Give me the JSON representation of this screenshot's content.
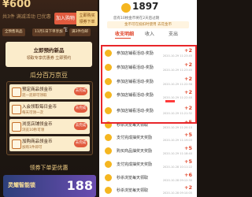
{
  "left": {
    "price": "¥600",
    "sub": "共3件 满减活动 已优惠",
    "cart_label": "加入购物车",
    "buy_label": "立即购买",
    "buy_sub": "领券下单",
    "tags": [
      "全预售商品",
      "11月1日下单享加",
      "满3件包邮"
    ],
    "coupon_title": "立即预约新品",
    "coupon_sub": "领取专享优惠券 立即预约",
    "section_title": "瓜分百万京豆",
    "tasks": [
      {
        "title": "预定商品领金币",
        "sub": "逛一逛即可领取",
        "go": "去完成"
      },
      {
        "title": "入会领取每日金币",
        "sub": "每天可领一次",
        "go": "去完成"
      },
      {
        "title": "浏览店铺领金币",
        "sub": "浏览10秒可领",
        "go": "去完成"
      },
      {
        "title": "加购商品领金币",
        "sub": "加购1件即可",
        "go": "去完成"
      }
    ],
    "order_title": "领券下单更优惠",
    "promo_title": "灵耀智能锁",
    "promo_num": "188"
  },
  "right": {
    "coin_count": "1897",
    "sub": "您有10枚金币将在2天后过期",
    "tip": "金币可在抵扣时使用 去花金币",
    "tabs": [
      "收支明细",
      "收入",
      "支出"
    ],
    "rows": [
      {
        "label": "参加店铺看活动-奖励",
        "value": "+2",
        "time": "2020-10-29 11:23:45"
      },
      {
        "label": "参加店铺看活动-奖励",
        "value": "+2",
        "time": "2020-10-29 11:23:45"
      },
      {
        "label": "参加店铺看活动-奖励",
        "value": "+2",
        "time": "2020-10-29 11:22:58"
      },
      {
        "label": "参加店铺看活动-奖励",
        "value": "+2",
        "time": "2020-10-29 11:22:40"
      },
      {
        "label": "参加店铺看活动-奖励",
        "value": "+2",
        "time": "2020-10-29 11:21:32"
      },
      {
        "label": "秒杀浏览每天领取",
        "value": "+5",
        "time": "2020-10-29 11:20:10"
      },
      {
        "label": "支付完成抽奖天奖励",
        "value": "+5",
        "time": "2020-10-29 11:19:03"
      },
      {
        "label": "购买商品抽奖天奖励",
        "value": "+5",
        "time": "2020-10-29 11:18:40"
      },
      {
        "label": "支付完成抽奖天奖励",
        "value": "+5",
        "time": "2020-10-28 10:11:22"
      },
      {
        "label": "秒杀浏览每天领取",
        "value": "+6",
        "time": "2020-10-28 09:12:30"
      },
      {
        "label": "秒杀浏览每天领取",
        "value": "+2",
        "time": "2020-10-28 09:10:05"
      }
    ]
  },
  "colors": {
    "accent": "#e0452a",
    "gold": "#f5b620",
    "highlight": "#e8262a"
  }
}
